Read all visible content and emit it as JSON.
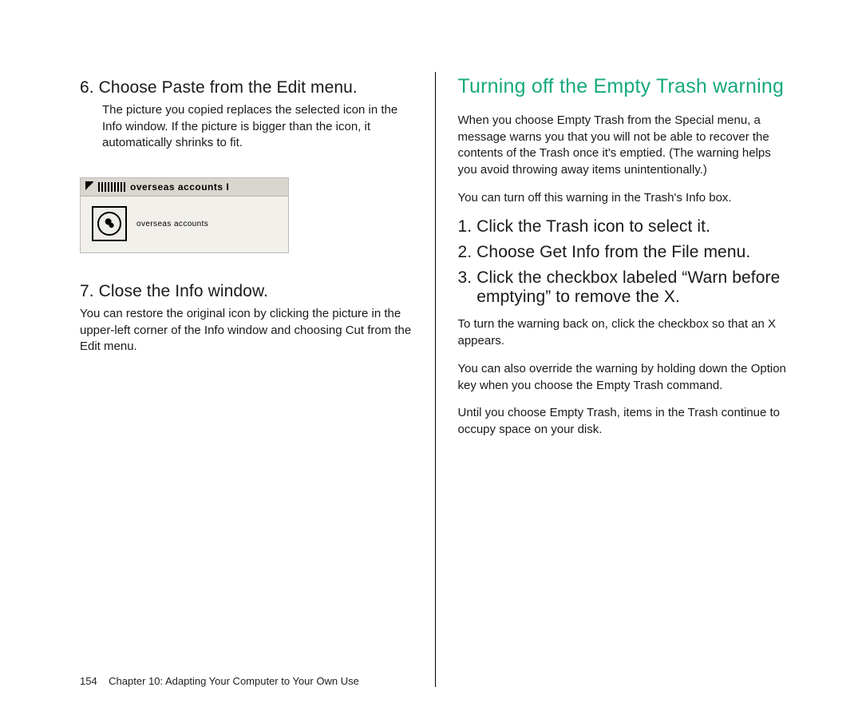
{
  "left": {
    "step6": {
      "num": "6.",
      "heading": "Choose Paste from the Edit menu.",
      "body": "The picture you copied replaces the selected icon in the Info window. If the picture is bigger than the icon, it automatically shrinks to fit."
    },
    "figure": {
      "titlebar_label": "overseas accounts I",
      "caption": "overseas accounts"
    },
    "step7": {
      "num": "7.",
      "heading": "Close the Info window.",
      "body": "You can restore the original icon by clicking the picture in the upper-left corner of the Info window and choosing Cut from the Edit menu."
    }
  },
  "right": {
    "title": "Turning off the Empty Trash warning",
    "intro": "When you choose Empty Trash from the Special menu, a message warns you that you will not be able to recover the contents of the Trash once it's emptied. (The warning helps you avoid throwing away items unintentionally.)",
    "intro2": "You can turn off this warning in the Trash's Info box.",
    "step1": {
      "num": "1.",
      "heading": "Click the Trash icon to select it."
    },
    "step2": {
      "num": "2.",
      "heading": "Choose Get Info from the File menu."
    },
    "step3": {
      "num": "3.",
      "heading": "Click the checkbox labeled “Warn before emptying” to remove the X."
    },
    "after1": "To turn the warning back on, click the checkbox so that an X appears.",
    "after2": "You can also override the warning by holding down the Option key when you choose the Empty Trash command.",
    "after3": "Until you choose Empty Trash, items in the Trash continue to occupy space on your disk."
  },
  "footer": {
    "page_num": "154",
    "chapter": "Chapter 10:  Adapting Your Computer to Your Own Use"
  }
}
